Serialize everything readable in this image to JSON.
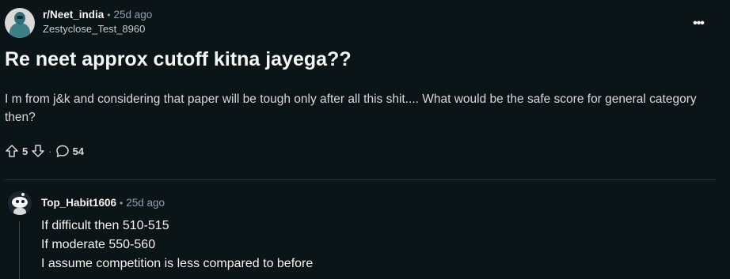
{
  "post": {
    "subreddit": "r/Neet_india",
    "separator": "•",
    "time_ago": "25d ago",
    "username": "Zestyclose_Test_8960",
    "more_label": "•••",
    "title": "Re neet approx cutoff kitna jayega??",
    "body": "I m from j&k and considering that paper will be tough only after all this shit.... What would be the safe score for general category then?",
    "upvotes": "5",
    "action_separator": "·",
    "comments": "54"
  },
  "comment": {
    "username": "Top_Habit1606",
    "separator": "•",
    "time_ago": "25d ago",
    "lines": [
      "If difficult then 510-515",
      "If moderate 550-560",
      "I assume competition is less compared to before"
    ]
  },
  "colors": {
    "background": "#0b1416",
    "text_primary": "#f2f4f5",
    "text_secondary": "#8ba2ad",
    "divider": "#2a3236"
  },
  "icons": {
    "upvote": "upvote-arrow-icon",
    "downvote": "downvote-arrow-icon",
    "comments": "comment-bubble-icon",
    "more": "more-options-icon"
  }
}
